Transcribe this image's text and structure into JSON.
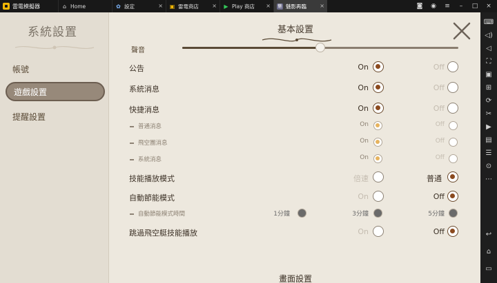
{
  "emulator": {
    "app_name": "雷電模擬器",
    "tabs": [
      {
        "label": "Home",
        "icon": "home-icon"
      },
      {
        "label": "設定",
        "icon": "gear-icon"
      },
      {
        "label": "雷電商店",
        "icon": "store-icon"
      },
      {
        "label": "Play 商店",
        "icon": "play-store-icon"
      },
      {
        "label": "魅影再臨",
        "icon": "game-icon"
      }
    ],
    "active_tab": 4
  },
  "game": {
    "left_title": "系統設置",
    "nav": [
      {
        "label": "帳號"
      },
      {
        "label": "遊戲設置"
      },
      {
        "label": "提醒設置"
      }
    ],
    "active_nav": 1,
    "section_title": "基本設置",
    "partial_label": "聲音",
    "volume_level_pct": 50,
    "rows": {
      "announcement": {
        "label": "公告",
        "on": "On",
        "off": "Off"
      },
      "system_msg": {
        "label": "系統消息",
        "on": "On",
        "off": "Off"
      },
      "quick_msg": {
        "label": "快捷消息",
        "on": "On",
        "off": "Off"
      },
      "normal_msg": {
        "label": "普通消息",
        "on": "On",
        "off": "Off"
      },
      "airship_msg": {
        "label": "飛空團消息",
        "on": "On",
        "off": "Off"
      },
      "sys_msg_sub": {
        "label": "系統消息",
        "on": "On",
        "off": "Off"
      },
      "skill_mode": {
        "label": "技能播放模式",
        "opt1": "倍速",
        "opt2": "普通"
      },
      "auto_save": {
        "label": "自動節能模式",
        "on": "On",
        "off": "Off"
      },
      "auto_save_time": {
        "label": "自動節能模式時間",
        "opt1": "1分鐘",
        "opt2": "3分鐘",
        "opt3": "5分鐘"
      },
      "skip_airship": {
        "label": "跳過飛空艇技能播放",
        "on": "On",
        "off": "Off"
      }
    },
    "footer_section": "畫面設置"
  },
  "colors": {
    "selected_dot": "#8b4a1f",
    "sub_selected_dot": "#e6b35f",
    "panel_bg": "#ede8de"
  }
}
